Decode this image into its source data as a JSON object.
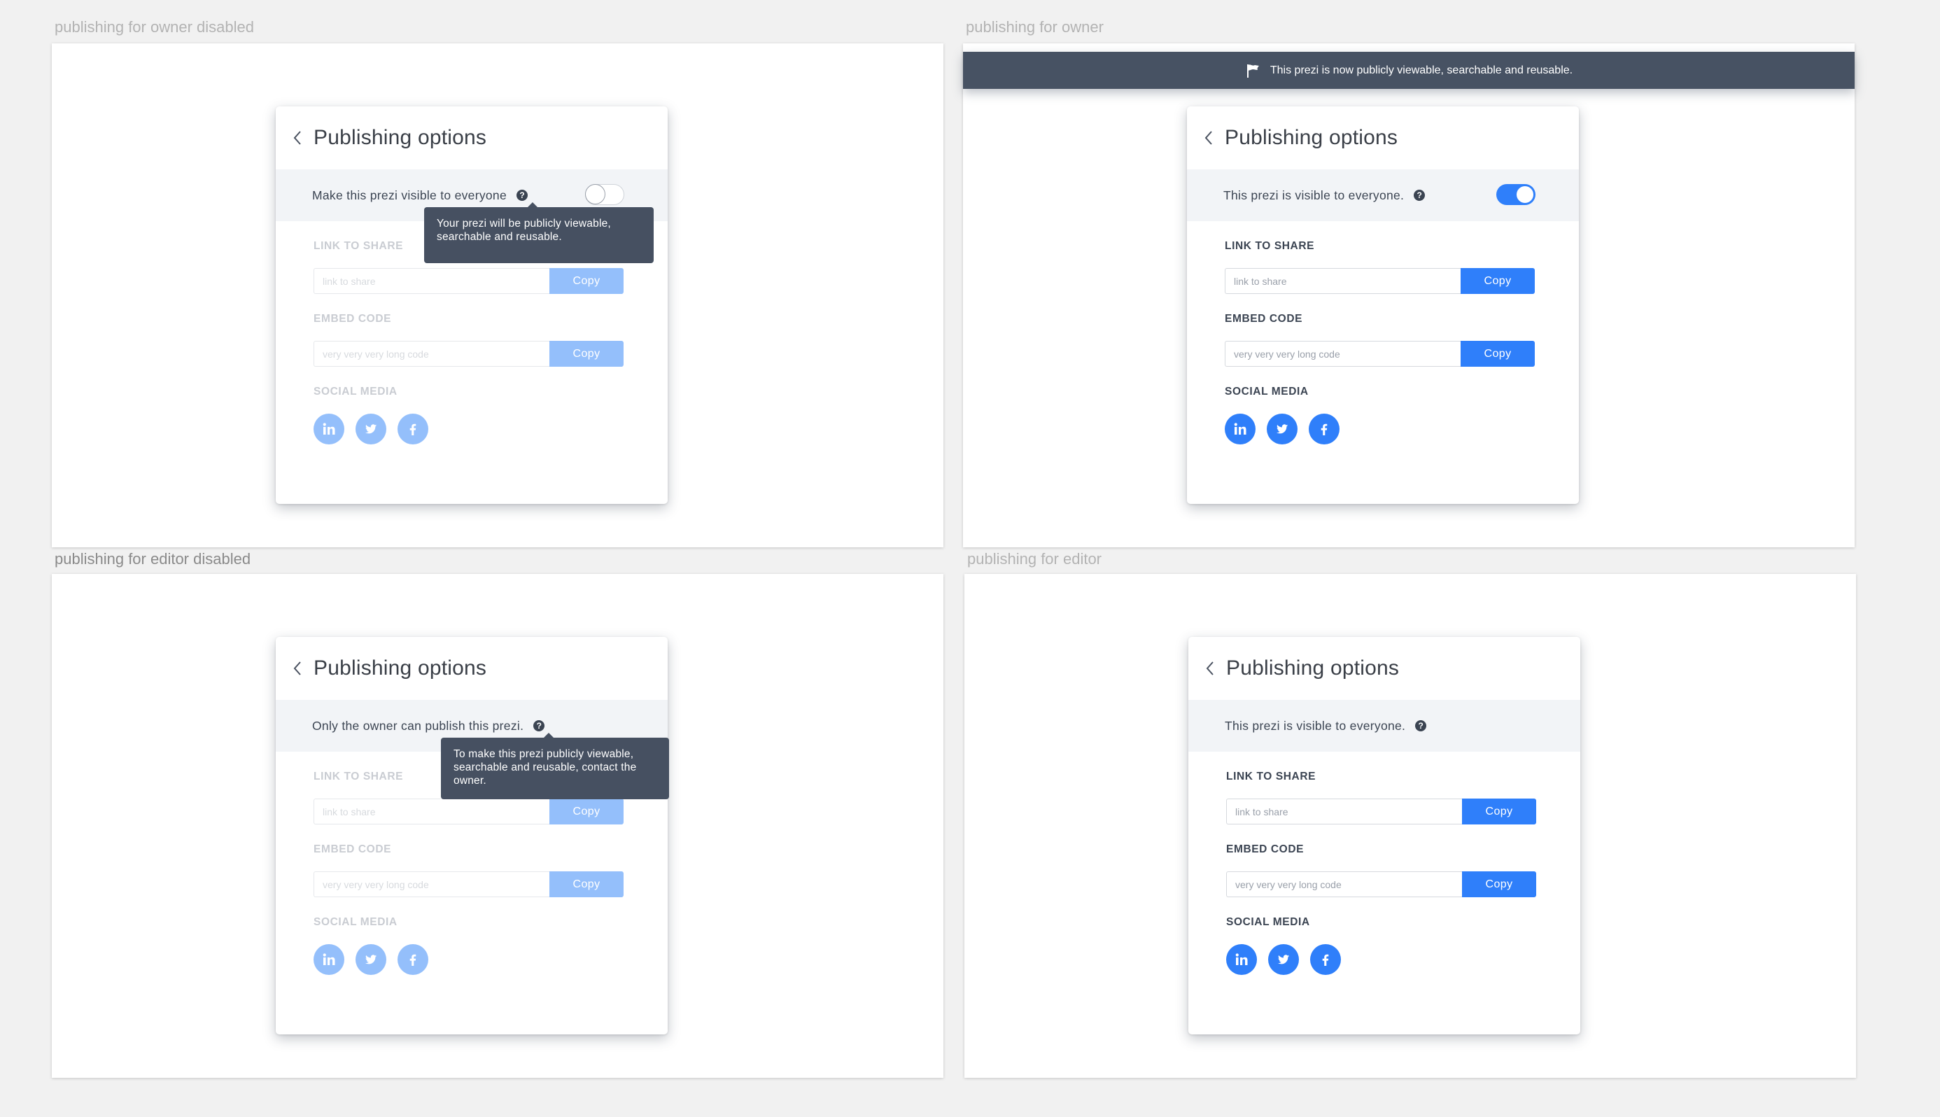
{
  "frames": [
    {
      "id": "owner-disabled",
      "label": "publishing for owner disabled",
      "card": {
        "title": "Publishing options",
        "band_text": "Make this prezi visible to everyone",
        "toggle_state": "off",
        "tooltip": "Your prezi will be publicly viewable, searchable and reusable.",
        "link_label": "LINK TO SHARE",
        "link_placeholder": "link to share",
        "embed_label": "EMBED CODE",
        "embed_placeholder": "very very very long code",
        "copy_label": "Copy",
        "social_label": "SOCIAL MEDIA"
      }
    },
    {
      "id": "owner",
      "label": "publishing for owner",
      "banner": "This prezi is now publicly viewable, searchable and reusable.",
      "card": {
        "title": "Publishing options",
        "band_text": "This prezi is visible to everyone.",
        "toggle_state": "on",
        "link_label": "LINK TO SHARE",
        "link_placeholder": "link to share",
        "embed_label": "EMBED CODE",
        "embed_placeholder": "very very very long code",
        "copy_label": "Copy",
        "social_label": "SOCIAL MEDIA"
      }
    },
    {
      "id": "editor-disabled",
      "label": "publishing for editor disabled",
      "card": {
        "title": "Publishing options",
        "band_text": "Only the owner can publish this prezi.",
        "tooltip": "To make this prezi publicly viewable, searchable and reusable, contact the owner.",
        "link_label": "LINK TO SHARE",
        "link_placeholder": "link to share",
        "embed_label": "EMBED CODE",
        "embed_placeholder": "very very very long code",
        "copy_label": "Copy",
        "social_label": "SOCIAL MEDIA"
      }
    },
    {
      "id": "editor",
      "label": "publishing for editor",
      "card": {
        "title": "Publishing options",
        "band_text": "This prezi is visible to everyone.",
        "link_label": "LINK TO SHARE",
        "link_placeholder": "link to share",
        "embed_label": "EMBED CODE",
        "embed_placeholder": "very very very long code",
        "copy_label": "Copy",
        "social_label": "SOCIAL MEDIA"
      }
    }
  ],
  "social_networks": [
    "linkedin",
    "twitter",
    "facebook"
  ],
  "colors": {
    "accent": "#2f7ffa",
    "accent_disabled": "#94bffb",
    "dark": "#465061",
    "band": "#f2f4f7",
    "canvas": "#f1f1f1"
  }
}
